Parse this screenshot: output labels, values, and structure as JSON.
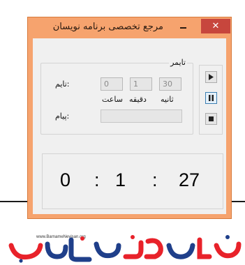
{
  "window": {
    "title": "مرجع تخصصی برنامه نویسان",
    "close_glyph": "✕"
  },
  "timer_group": {
    "legend": "تایمر",
    "time_label": ":تایم",
    "message_label": ":پیام",
    "hours_value": "0",
    "minutes_value": "1",
    "seconds_value": "30",
    "hours_unit": "ساعت",
    "minutes_unit": "دقیقه",
    "seconds_unit": "ثانیه",
    "message_value": ""
  },
  "controls": [
    {
      "name": "play",
      "icon": "play-icon"
    },
    {
      "name": "pause",
      "icon": "pause-icon",
      "active": true
    },
    {
      "name": "stop",
      "icon": "stop-icon"
    }
  ],
  "countdown": {
    "hours": "0",
    "sep1": ":",
    "minutes": "1",
    "sep2": ":",
    "seconds": "27"
  },
  "logo": {
    "url_text": "www.BarnameNevisan.org"
  },
  "colors": {
    "window_frame": "#f6a36e",
    "close_button": "#c7463d",
    "logo_red": "#e8222a",
    "logo_blue": "#1f3f8a"
  }
}
